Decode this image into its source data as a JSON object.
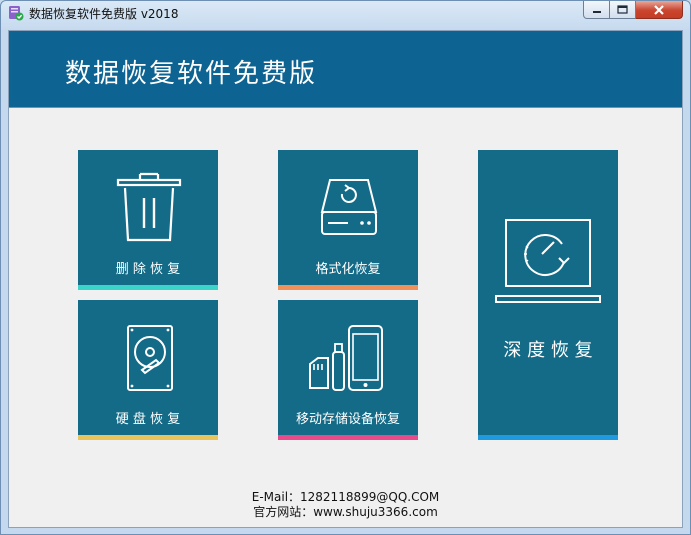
{
  "window": {
    "title": "数据恢复软件免费版 v2018"
  },
  "header": {
    "title": "数据恢复软件免费版"
  },
  "tiles": {
    "delete_recovery": {
      "label": "删 除 恢 复",
      "icon": "trash-can-icon",
      "accent": "#3ad4c8"
    },
    "format_recovery": {
      "label": "格式化恢复",
      "icon": "hard-drive-refresh-icon",
      "accent": "#f0915a"
    },
    "disk_recovery": {
      "label": "硬 盘 恢 复",
      "icon": "hard-disk-icon",
      "accent": "#e8c45a"
    },
    "mobile_recovery": {
      "label": "移动存储设备恢复",
      "icon": "mobile-devices-icon",
      "accent": "#e84a8a"
    },
    "deep_recovery": {
      "label": "深 度 恢 复",
      "icon": "laptop-scan-icon",
      "accent": "#1f9ae0"
    }
  },
  "footer": {
    "email": "E-Mail：1282118899@QQ.COM",
    "website": "官方网站：www.shuju3366.com"
  },
  "colors": {
    "header_bg": "#0d6391",
    "tile_bg": "#146b87"
  }
}
